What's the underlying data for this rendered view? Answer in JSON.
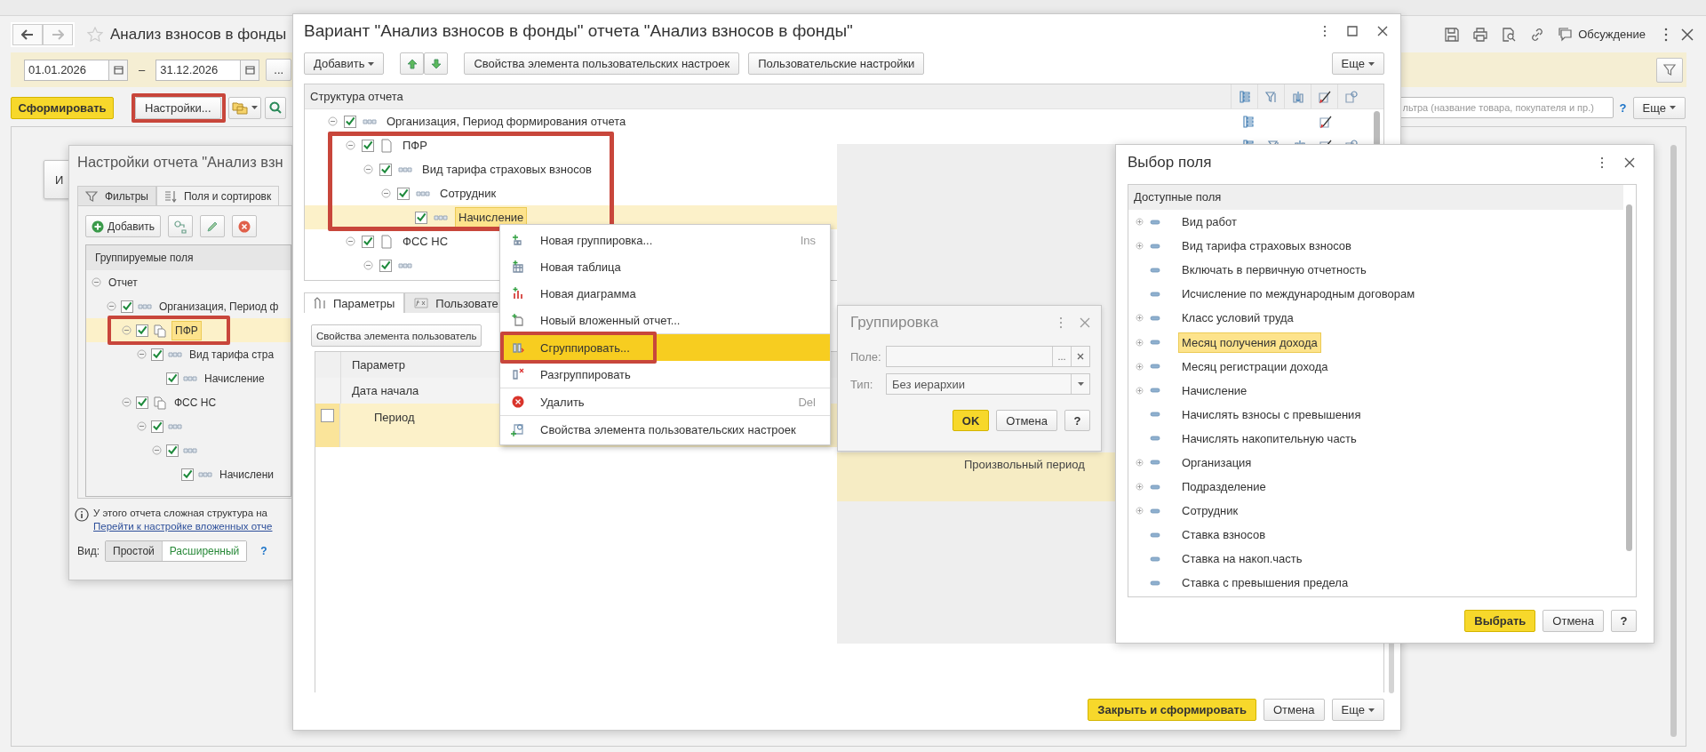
{
  "main": {
    "title": "Анализ взносов в фонды",
    "discussion_label": "Обсуждение",
    "period": {
      "from": "01.01.2026",
      "separator": "–",
      "to": "31.12.2026",
      "choose_label": "..."
    },
    "generate_label": "Сформировать",
    "settings_label": "Настройки...",
    "settings_highlighted": true,
    "search": {
      "placeholder": "льтра (название товара, покупателя и пр.)",
      "help": "?"
    },
    "more_label": "Еще",
    "report_button_fragment": "И"
  },
  "settings_window": {
    "title": "Настройки отчета \"Анализ взн",
    "tabs": [
      {
        "label": "Фильтры",
        "selected": false
      },
      {
        "label": "Поля и сортировк",
        "selected": true
      }
    ],
    "add_label": "Добавить",
    "tree": {
      "header": "Группируемые поля",
      "nodes": [
        {
          "label": "Отчет",
          "expanded": true,
          "selected": false,
          "children": [
            {
              "label": "Организация, Период ф",
              "kind": "grouping",
              "checked": true,
              "expanded": true,
              "selected": false,
              "children": [
                {
                  "label": "ПФР",
                  "kind": "report",
                  "checked": true,
                  "expanded": true,
                  "selected": true,
                  "highlighted": true,
                  "children": [
                    {
                      "label": "Вид тарифа стра",
                      "kind": "grouping",
                      "checked": true,
                      "expanded": true,
                      "selected": false,
                      "children": [
                        {
                          "label": "Начисление",
                          "kind": "grouping",
                          "checked": true,
                          "selected": false
                        }
                      ]
                    }
                  ]
                },
                {
                  "label": "ФСС НС",
                  "kind": "report",
                  "checked": true,
                  "expanded": true,
                  "selected": false,
                  "children": [
                    {
                      "kind": "grouping",
                      "checked": true,
                      "expanded": true,
                      "selected": false,
                      "children": [
                        {
                          "kind": "grouping",
                          "checked": true,
                          "expanded": true,
                          "selected": false,
                          "children": [
                            {
                              "label": "Начислени",
                              "kind": "grouping",
                              "checked": true,
                              "selected": false
                            }
                          ]
                        }
                      ]
                    }
                  ]
                }
              ]
            }
          ]
        }
      ]
    },
    "note": "У этого отчета сложная структура на",
    "note_link": "Перейти к настройке вложенных отче",
    "view": {
      "label": "Вид:",
      "options": [
        {
          "label": "Простой",
          "selected": true
        },
        {
          "label": "Расширенный",
          "selected": false
        }
      ],
      "help": "?"
    }
  },
  "variant_window": {
    "title": "Вариант \"Анализ взносов в фонды\" отчета \"Анализ взносов в фонды\"",
    "add_label": "Добавить",
    "properties_label": "Свойства элемента пользовательских настроек",
    "user_settings_label": "Пользовательские настройки",
    "more_label": "Еще",
    "structure": {
      "header": "Структура отчета",
      "nodes": [
        {
          "label": "Организация, Период формирования отчета",
          "kind": "grouping",
          "checked": true,
          "expanded": true,
          "selected": false,
          "column_icons": [
            true,
            false,
            false,
            true,
            false
          ],
          "children": [
            {
              "label": "ПФР",
              "kind": "report",
              "checked": true,
              "expanded": true,
              "selected": false,
              "highlighted": true,
              "column_icons": [
                true,
                true,
                true,
                true,
                true
              ],
              "children": [
                {
                  "label": "Вид тарифа страховых взносов",
                  "kind": "grouping",
                  "checked": true,
                  "expanded": true,
                  "selected": false,
                  "children": [
                    {
                      "label": "Сотрудник",
                      "kind": "grouping",
                      "checked": true,
                      "expanded": true,
                      "selected": false,
                      "children": [
                        {
                          "label": "Начисление",
                          "kind": "grouping",
                          "checked": true,
                          "selected": true
                        }
                      ]
                    }
                  ]
                }
              ]
            },
            {
              "label": "ФСС НС",
              "kind": "report",
              "checked": true,
              "expanded": true,
              "selected": false,
              "children": [
                {
                  "kind": "grouping",
                  "checked": true,
                  "expanded": true,
                  "selected": false
                }
              ]
            }
          ]
        }
      ]
    },
    "tabs": [
      {
        "label": "Параметры",
        "selected": true
      },
      {
        "label": "Пользовате",
        "selected": false
      }
    ],
    "tab_properties_label": "Свойства элемента пользователь",
    "params": {
      "header": "Параметр",
      "rows": [
        {
          "kind": "group",
          "label": "Дата начала"
        },
        {
          "kind": "param",
          "label": "Период",
          "checked": false,
          "selected": true,
          "value": "Произвольный период"
        }
      ]
    },
    "close_generate_label": "Закрыть и сформировать",
    "cancel_label": "Отмена",
    "more_bottom_label": "Еще"
  },
  "context_menu": {
    "items": [
      {
        "kind": "new-grouping",
        "label": "Новая группировка...",
        "shortcut": "Ins",
        "selected": false
      },
      {
        "kind": "new-table",
        "label": "Новая таблица",
        "selected": false
      },
      {
        "kind": "new-chart",
        "label": "Новая диаграмма",
        "selected": false
      },
      {
        "kind": "new-report",
        "label": "Новый вложенный отчет...",
        "selected": false
      },
      {
        "kind": "group",
        "label": "Сгруппировать...",
        "selected": true,
        "highlighted": true,
        "separator_before": true
      },
      {
        "kind": "ungroup",
        "label": "Разгруппировать",
        "selected": false
      },
      {
        "kind": "delete",
        "label": "Удалить",
        "shortcut": "Del",
        "selected": false,
        "separator_before": true
      },
      {
        "kind": "properties",
        "label": "Свойства элемента пользовательских настроек",
        "selected": false,
        "separator_before": true
      }
    ]
  },
  "grouping_dialog": {
    "title": "Группировка",
    "field_label": "Поле:",
    "choose_label": "...",
    "type_label": "Тип:",
    "type_value": "Без иерархии",
    "ok_label": "OK",
    "cancel_label": "Отмена",
    "help_label": "?"
  },
  "field_picker": {
    "title": "Выбор поля",
    "header": "Доступные поля",
    "items": [
      {
        "label": "Вид работ",
        "expanded": false,
        "selected": false
      },
      {
        "label": "Вид тарифа страховых взносов",
        "expanded": false,
        "selected": false
      },
      {
        "label": "Включать в первичную отчетность",
        "selected": false
      },
      {
        "label": "Исчисление по международным договорам",
        "selected": false
      },
      {
        "label": "Класс условий труда",
        "expanded": false,
        "selected": false
      },
      {
        "label": "Месяц получения дохода",
        "expanded": false,
        "selected": true
      },
      {
        "label": "Месяц регистрации дохода",
        "expanded": false,
        "selected": false
      },
      {
        "label": "Начисление",
        "expanded": false,
        "selected": false
      },
      {
        "label": "Начислять взносы с превышения",
        "selected": false
      },
      {
        "label": "Начислять накопительную часть",
        "selected": false
      },
      {
        "label": "Организация",
        "expanded": false,
        "selected": false
      },
      {
        "label": "Подразделение",
        "expanded": false,
        "selected": false
      },
      {
        "label": "Сотрудник",
        "expanded": false,
        "selected": false
      },
      {
        "label": "Ставка взносов",
        "selected": false
      },
      {
        "label": "Ставка на накоп.часть",
        "selected": false
      },
      {
        "label": "Ставка с превышения предела",
        "selected": false
      }
    ],
    "select_label": "Выбрать",
    "cancel_label": "Отмена",
    "help_label": "?"
  }
}
